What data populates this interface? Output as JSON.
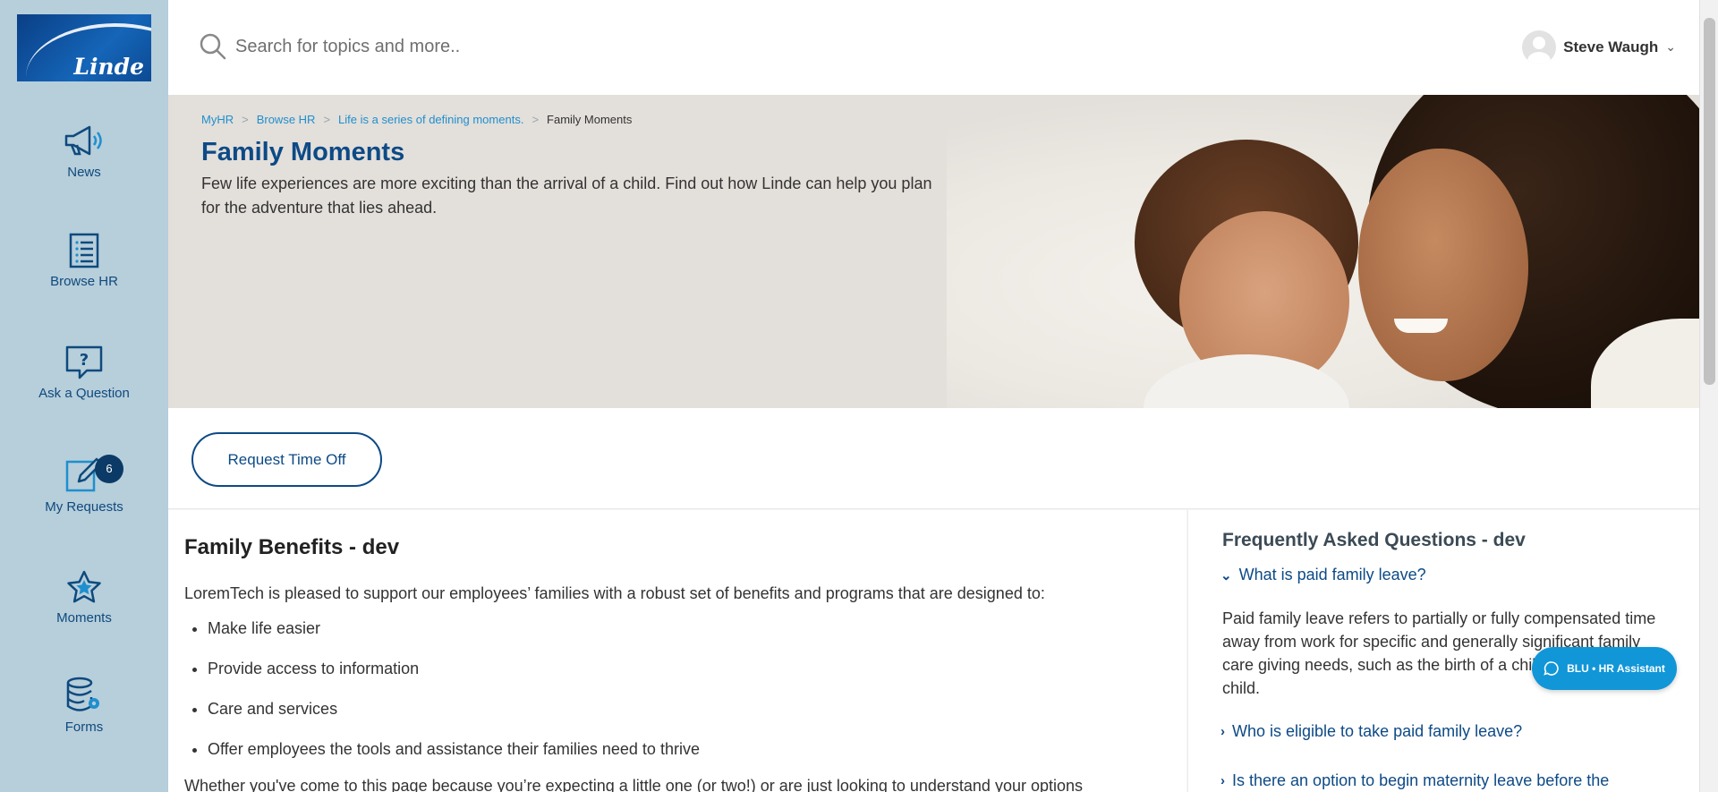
{
  "brand": {
    "logo_text": "Linde",
    "accent": "#0d4a86",
    "link": "#1f8fce"
  },
  "sidebar": {
    "items": [
      {
        "label": "News",
        "icon": "megaphone-icon"
      },
      {
        "label": "Browse HR",
        "icon": "list-document-icon"
      },
      {
        "label": "Ask a Question",
        "icon": "question-bubble-icon"
      },
      {
        "label": "My Requests",
        "icon": "edit-pencil-icon",
        "badge": "6"
      },
      {
        "label": "Moments",
        "icon": "star-icon"
      },
      {
        "label": "Forms",
        "icon": "database-gear-icon"
      }
    ]
  },
  "header": {
    "search_placeholder": "Search for topics and more..",
    "user_name": "Steve Waugh"
  },
  "breadcrumb": {
    "items": [
      "MyHR",
      "Browse HR",
      "Life is a series of defining moments."
    ],
    "current": "Family Moments",
    "sep": ">"
  },
  "hero": {
    "title": "Family Moments",
    "intro": "Few life experiences are more exciting than the arrival of a child. Find out how Linde can help you plan for the adventure that lies ahead."
  },
  "actions": {
    "request_time_off": "Request Time Off"
  },
  "main": {
    "title": "Family Benefits - dev",
    "intro": "LoremTech is pleased to support our employees’ families with a robust set of benefits and programs that are designed to:",
    "bullets": [
      "Make life easier",
      "Provide access to information",
      "Care and services",
      "Offer employees the tools and assistance their families need to thrive"
    ],
    "more": "Whether you've come to this page because you’re expecting a little one (or two!) or are just looking to understand your options"
  },
  "faq": {
    "title": "Frequently Asked Questions - dev",
    "items": [
      {
        "q": "What is paid family leave?",
        "expanded": true
      },
      {
        "q": "Who is eligible to take paid family leave?",
        "expanded": false
      },
      {
        "q": "Is there an option to begin maternity leave before the",
        "expanded": false
      }
    ],
    "answer": "Paid family leave refers to partially or fully compensated time away from work for specific and generally significant family care giving needs, such as the birth of a child, adoption of a child."
  },
  "assistant": {
    "label": "BLU • HR Assistant"
  }
}
